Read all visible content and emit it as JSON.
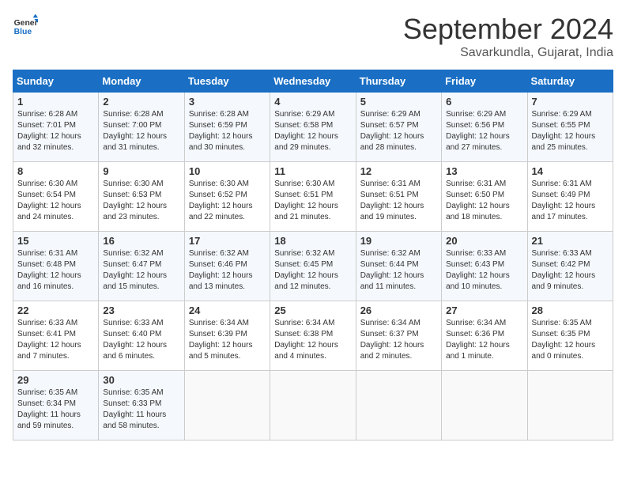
{
  "header": {
    "logo_line1": "General",
    "logo_line2": "Blue",
    "month": "September 2024",
    "location": "Savarkundla, Gujarat, India"
  },
  "weekdays": [
    "Sunday",
    "Monday",
    "Tuesday",
    "Wednesday",
    "Thursday",
    "Friday",
    "Saturday"
  ],
  "weeks": [
    [
      {
        "day": "1",
        "lines": [
          "Sunrise: 6:28 AM",
          "Sunset: 7:01 PM",
          "Daylight: 12 hours",
          "and 32 minutes."
        ]
      },
      {
        "day": "2",
        "lines": [
          "Sunrise: 6:28 AM",
          "Sunset: 7:00 PM",
          "Daylight: 12 hours",
          "and 31 minutes."
        ]
      },
      {
        "day": "3",
        "lines": [
          "Sunrise: 6:28 AM",
          "Sunset: 6:59 PM",
          "Daylight: 12 hours",
          "and 30 minutes."
        ]
      },
      {
        "day": "4",
        "lines": [
          "Sunrise: 6:29 AM",
          "Sunset: 6:58 PM",
          "Daylight: 12 hours",
          "and 29 minutes."
        ]
      },
      {
        "day": "5",
        "lines": [
          "Sunrise: 6:29 AM",
          "Sunset: 6:57 PM",
          "Daylight: 12 hours",
          "and 28 minutes."
        ]
      },
      {
        "day": "6",
        "lines": [
          "Sunrise: 6:29 AM",
          "Sunset: 6:56 PM",
          "Daylight: 12 hours",
          "and 27 minutes."
        ]
      },
      {
        "day": "7",
        "lines": [
          "Sunrise: 6:29 AM",
          "Sunset: 6:55 PM",
          "Daylight: 12 hours",
          "and 25 minutes."
        ]
      }
    ],
    [
      {
        "day": "8",
        "lines": [
          "Sunrise: 6:30 AM",
          "Sunset: 6:54 PM",
          "Daylight: 12 hours",
          "and 24 minutes."
        ]
      },
      {
        "day": "9",
        "lines": [
          "Sunrise: 6:30 AM",
          "Sunset: 6:53 PM",
          "Daylight: 12 hours",
          "and 23 minutes."
        ]
      },
      {
        "day": "10",
        "lines": [
          "Sunrise: 6:30 AM",
          "Sunset: 6:52 PM",
          "Daylight: 12 hours",
          "and 22 minutes."
        ]
      },
      {
        "day": "11",
        "lines": [
          "Sunrise: 6:30 AM",
          "Sunset: 6:51 PM",
          "Daylight: 12 hours",
          "and 21 minutes."
        ]
      },
      {
        "day": "12",
        "lines": [
          "Sunrise: 6:31 AM",
          "Sunset: 6:51 PM",
          "Daylight: 12 hours",
          "and 19 minutes."
        ]
      },
      {
        "day": "13",
        "lines": [
          "Sunrise: 6:31 AM",
          "Sunset: 6:50 PM",
          "Daylight: 12 hours",
          "and 18 minutes."
        ]
      },
      {
        "day": "14",
        "lines": [
          "Sunrise: 6:31 AM",
          "Sunset: 6:49 PM",
          "Daylight: 12 hours",
          "and 17 minutes."
        ]
      }
    ],
    [
      {
        "day": "15",
        "lines": [
          "Sunrise: 6:31 AM",
          "Sunset: 6:48 PM",
          "Daylight: 12 hours",
          "and 16 minutes."
        ]
      },
      {
        "day": "16",
        "lines": [
          "Sunrise: 6:32 AM",
          "Sunset: 6:47 PM",
          "Daylight: 12 hours",
          "and 15 minutes."
        ]
      },
      {
        "day": "17",
        "lines": [
          "Sunrise: 6:32 AM",
          "Sunset: 6:46 PM",
          "Daylight: 12 hours",
          "and 13 minutes."
        ]
      },
      {
        "day": "18",
        "lines": [
          "Sunrise: 6:32 AM",
          "Sunset: 6:45 PM",
          "Daylight: 12 hours",
          "and 12 minutes."
        ]
      },
      {
        "day": "19",
        "lines": [
          "Sunrise: 6:32 AM",
          "Sunset: 6:44 PM",
          "Daylight: 12 hours",
          "and 11 minutes."
        ]
      },
      {
        "day": "20",
        "lines": [
          "Sunrise: 6:33 AM",
          "Sunset: 6:43 PM",
          "Daylight: 12 hours",
          "and 10 minutes."
        ]
      },
      {
        "day": "21",
        "lines": [
          "Sunrise: 6:33 AM",
          "Sunset: 6:42 PM",
          "Daylight: 12 hours",
          "and 9 minutes."
        ]
      }
    ],
    [
      {
        "day": "22",
        "lines": [
          "Sunrise: 6:33 AM",
          "Sunset: 6:41 PM",
          "Daylight: 12 hours",
          "and 7 minutes."
        ]
      },
      {
        "day": "23",
        "lines": [
          "Sunrise: 6:33 AM",
          "Sunset: 6:40 PM",
          "Daylight: 12 hours",
          "and 6 minutes."
        ]
      },
      {
        "day": "24",
        "lines": [
          "Sunrise: 6:34 AM",
          "Sunset: 6:39 PM",
          "Daylight: 12 hours",
          "and 5 minutes."
        ]
      },
      {
        "day": "25",
        "lines": [
          "Sunrise: 6:34 AM",
          "Sunset: 6:38 PM",
          "Daylight: 12 hours",
          "and 4 minutes."
        ]
      },
      {
        "day": "26",
        "lines": [
          "Sunrise: 6:34 AM",
          "Sunset: 6:37 PM",
          "Daylight: 12 hours",
          "and 2 minutes."
        ]
      },
      {
        "day": "27",
        "lines": [
          "Sunrise: 6:34 AM",
          "Sunset: 6:36 PM",
          "Daylight: 12 hours",
          "and 1 minute."
        ]
      },
      {
        "day": "28",
        "lines": [
          "Sunrise: 6:35 AM",
          "Sunset: 6:35 PM",
          "Daylight: 12 hours",
          "and 0 minutes."
        ]
      }
    ],
    [
      {
        "day": "29",
        "lines": [
          "Sunrise: 6:35 AM",
          "Sunset: 6:34 PM",
          "Daylight: 11 hours",
          "and 59 minutes."
        ]
      },
      {
        "day": "30",
        "lines": [
          "Sunrise: 6:35 AM",
          "Sunset: 6:33 PM",
          "Daylight: 11 hours",
          "and 58 minutes."
        ]
      },
      {
        "day": "",
        "lines": []
      },
      {
        "day": "",
        "lines": []
      },
      {
        "day": "",
        "lines": []
      },
      {
        "day": "",
        "lines": []
      },
      {
        "day": "",
        "lines": []
      }
    ]
  ]
}
